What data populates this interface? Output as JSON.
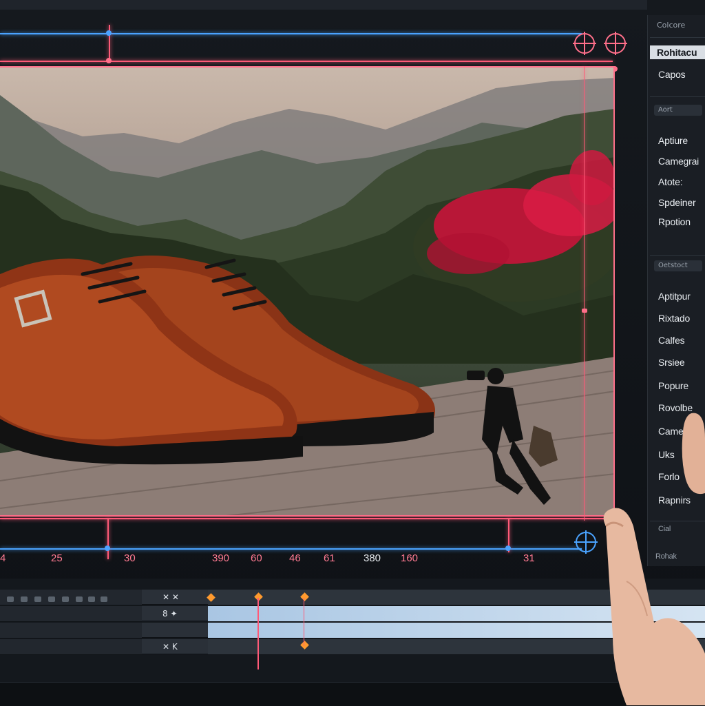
{
  "panel": {
    "header": "Colcore",
    "items_top": [
      {
        "label": "Rohitacu",
        "active": true
      },
      {
        "label": "Capos",
        "active": false
      }
    ],
    "section_1": "Aort",
    "items_mid": [
      "Aptiure",
      "Camegrai",
      "Atote:",
      "Spdeiner",
      "Rpotion"
    ],
    "section_2": "Oetstoct",
    "items_bottom": [
      "Aptitpur",
      "Rixtado",
      "Calfes",
      "Srsiee",
      "Popure",
      "Rovolbe",
      "Came",
      "Uks",
      "Forlo",
      "Rapnirs"
    ],
    "footer_1": "Cial",
    "footer_2": "Rohak"
  },
  "ruler": {
    "labels": [
      {
        "text": "4",
        "tone": "pink"
      },
      {
        "text": "25",
        "tone": "pink"
      },
      {
        "text": "30",
        "tone": "pink"
      },
      {
        "text": "390",
        "tone": "pink"
      },
      {
        "text": "60",
        "tone": "pink"
      },
      {
        "text": "46",
        "tone": "pink"
      },
      {
        "text": "61",
        "tone": "pink"
      },
      {
        "text": "380",
        "tone": "white"
      },
      {
        "text": "160",
        "tone": "pink"
      },
      {
        "text": "31",
        "tone": "pink"
      }
    ]
  },
  "timeline": {
    "tracks": [
      {
        "ctrl": "✕ ✕"
      },
      {
        "ctrl": "8 ✦"
      },
      {
        "ctrl": "",
        "selected": true
      },
      {
        "ctrl": "✕ K"
      }
    ]
  },
  "colors": {
    "guide_blue": "#4aa3ff",
    "guide_pink": "#ff5a78",
    "keyframe": "#ff9a2e",
    "lane_selected": "#c7dcef"
  },
  "icons": [
    "crosshair-target-icon",
    "guide-handle-icon",
    "keyframe-diamond-icon",
    "playhead-icon"
  ]
}
